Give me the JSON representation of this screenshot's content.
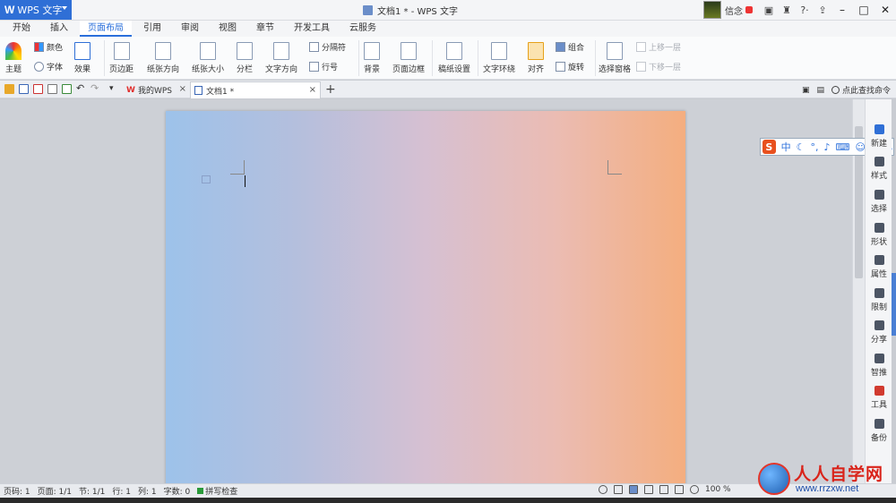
{
  "app": {
    "name": "WPS 文字",
    "logo": "W",
    "window_title": "文档1 * - WPS 文字"
  },
  "user": {
    "name": "信念"
  },
  "title_icons": [
    "notify-icon",
    "skin-icon",
    "help-icon",
    "window-restore-icon"
  ],
  "help_label": "?·",
  "tabs": [
    "开始",
    "插入",
    "页面布局",
    "引用",
    "审阅",
    "视图",
    "章节",
    "开发工具",
    "云服务"
  ],
  "active_tab": "页面布局",
  "ribbon": {
    "theme": "主题",
    "color": "颜色",
    "font": "字体",
    "effect": "效果",
    "margins": "页边距",
    "orientation": "纸张方向",
    "size": "纸张大小",
    "columns": "分栏",
    "text_direction": "文字方向",
    "separator": "分隔符",
    "line_number": "行号",
    "background": "背景",
    "page_border": "页面边框",
    "manuscript": "稿纸设置",
    "wrap_text": "文字环绕",
    "align": "对齐",
    "group": "组合",
    "rotate": "旋转",
    "selection_pane": "选择窗格",
    "bring_forward": "上移一层",
    "send_backward": "下移一层"
  },
  "doc_tabs": {
    "my_wps": "我的WPS",
    "doc1": "文档1 *",
    "find_command": "点此查找命令"
  },
  "side_panel": [
    "新建",
    "样式",
    "选择",
    "形状",
    "属性",
    "限制",
    "分享",
    "智推",
    "工具",
    "备份"
  ],
  "ime": {
    "logo": "S",
    "mode": "中"
  },
  "status": {
    "page_code": "页码: 1",
    "page": "页面: 1/1",
    "section": "节: 1/1",
    "row": "行: 1",
    "col": "列: 1",
    "words": "字数: 0",
    "spell_check": "拼写检查",
    "zoom": "100 %"
  },
  "watermark": {
    "cn": "人人自学网",
    "url": "www.rrzxw.net"
  },
  "colors": {
    "accent": "#2a6fdb",
    "page_gradient": [
      "#9dc2ea",
      "#b4bfdd",
      "#d6c0d2",
      "#ebbcb3",
      "#f4ae7f"
    ]
  }
}
